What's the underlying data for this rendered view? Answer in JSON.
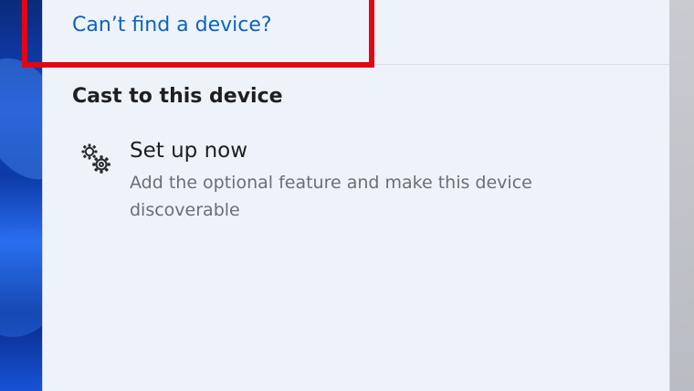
{
  "flyout": {
    "cant_find_link": "Can’t find a device?",
    "section_title": "Cast to this device",
    "setup": {
      "title": "Set up now",
      "description": "Add the optional feature and make this device discoverable",
      "icon": "gears-icon"
    }
  },
  "colors": {
    "link": "#0a64c2",
    "panel_bg": "#eef3fa",
    "highlight": "#e30613",
    "text_primary": "#1f1f1f",
    "text_secondary": "#6b6f75"
  }
}
